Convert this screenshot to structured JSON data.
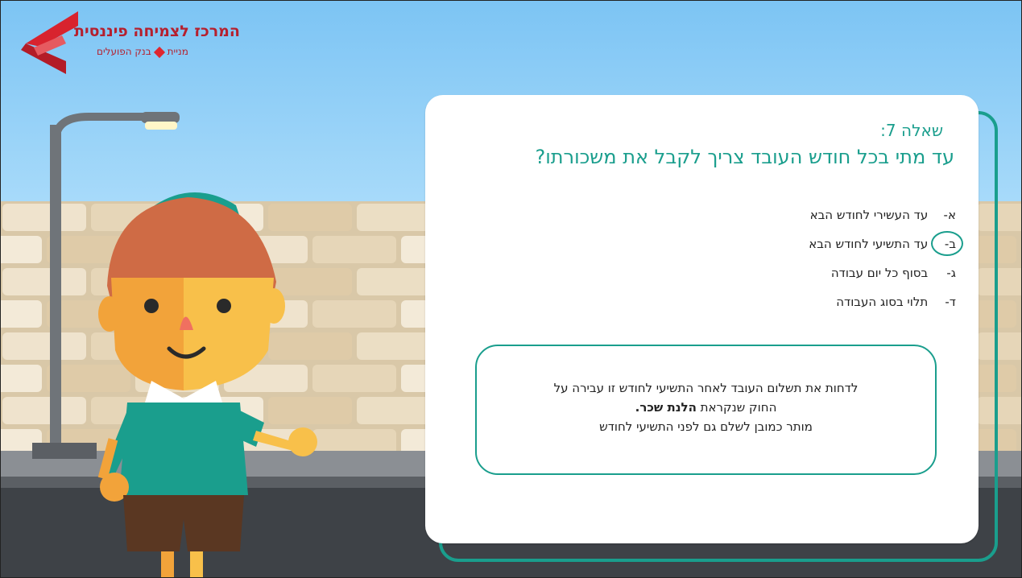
{
  "logo": {
    "title": "המרכז לצמיחה פיננסית",
    "subtitle_left": "מניית",
    "subtitle_right": "בנק הפועלים",
    "brand_color": "#b5202e"
  },
  "question": {
    "number": "שאלה 7:",
    "text": "עד מתי בכל חודש העובד צריך לקבל את משכורתו?",
    "answers": [
      {
        "letter": "א-",
        "text": "עד העשירי לחודש הבא"
      },
      {
        "letter": "ב-",
        "text": "עד התשיעי לחודש הבא",
        "selected": true
      },
      {
        "letter": "ג-",
        "text": "בסוף כל יום עבודה"
      },
      {
        "letter": "ד-",
        "text": "תלוי בסוג העבודה"
      }
    ]
  },
  "info": {
    "line1": "לדחות את תשלום העובד לאחר התשיעי לחודש זו עבירה על",
    "line2_prefix": "החוק שנקראת ",
    "line2_bold": "הלנת שכר.",
    "line3": "מותר כמובן לשלם גם לפני התשיעי לחודש"
  },
  "colors": {
    "accent": "#1a9e8d",
    "sky": "#8fd0f8",
    "wall": "#e9dcc5"
  }
}
